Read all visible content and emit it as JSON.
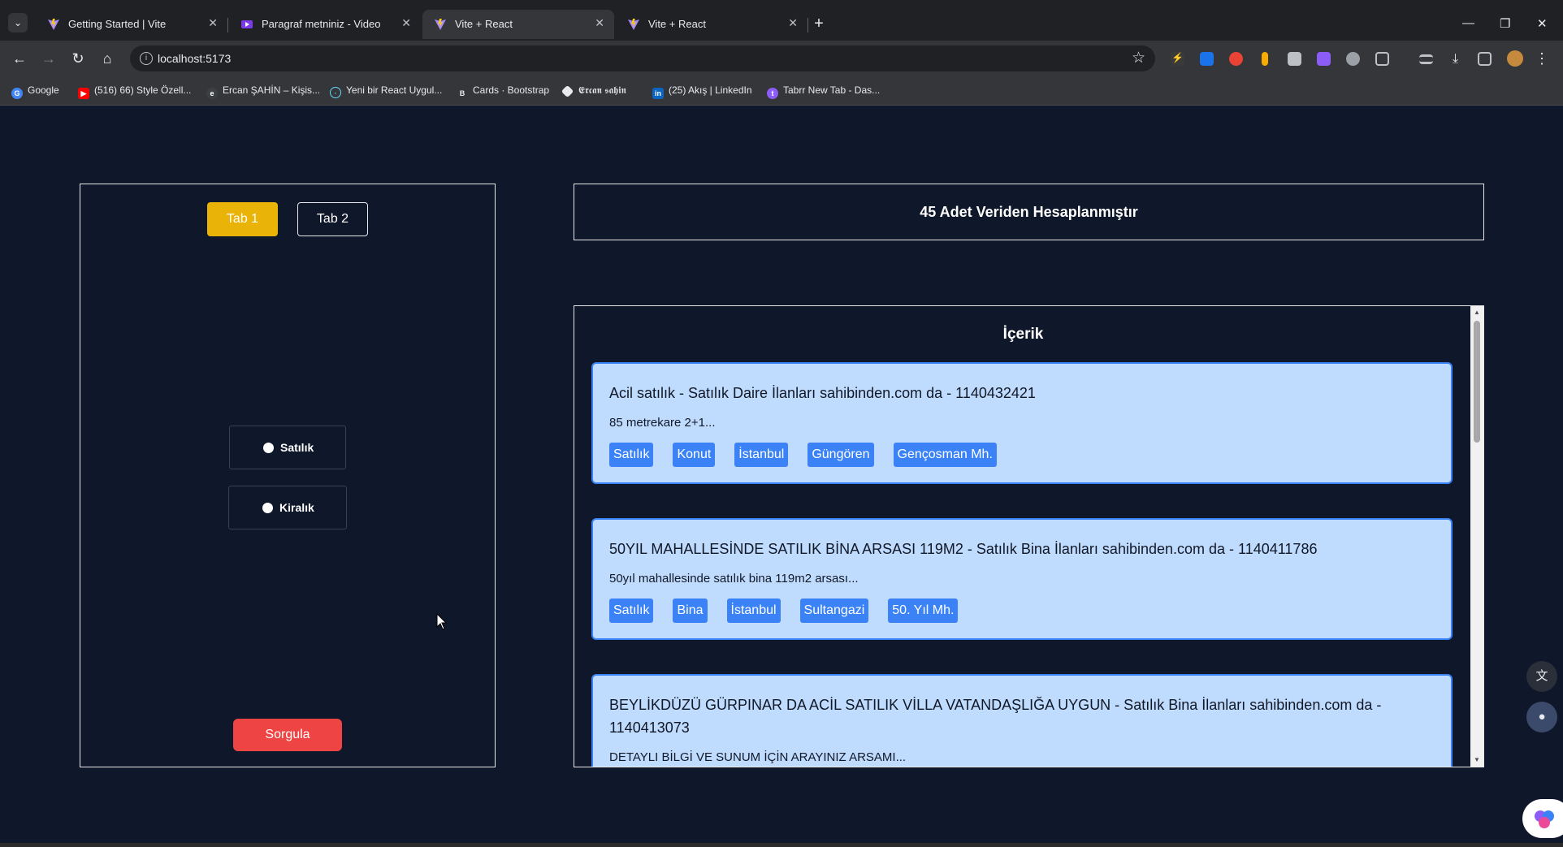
{
  "browser": {
    "tabs": [
      {
        "title": "Getting Started | Vite",
        "active": false
      },
      {
        "title": "Paragraf metniniz - Video",
        "active": false
      },
      {
        "title": "Vite + React",
        "active": true
      },
      {
        "title": "Vite + React",
        "active": false
      }
    ],
    "url": "localhost:5173",
    "bookmarks": [
      {
        "label": "Google",
        "icon": "google-icon",
        "color": "#4285f4"
      },
      {
        "label": "(516) 66) Style Özell...",
        "icon": "youtube-icon",
        "color": "#ff0000"
      },
      {
        "label": "Ercan ŞAHİN – Kişis...",
        "icon": "site-icon",
        "color": "#5f6368"
      },
      {
        "label": "Yeni bir React Uygul...",
        "icon": "react-icon",
        "color": "#61dafb"
      },
      {
        "label": "Cards · Bootstrap",
        "icon": "bootstrap-icon",
        "color": "#7952b3"
      },
      {
        "label": "𝕰𝖗𝖈𝖆𝖓 𝖘𝖆𝖍𝖎𝖓",
        "icon": "diamond-icon",
        "color": "#e8eaed"
      },
      {
        "label": "(25) Akış | LinkedIn",
        "icon": "linkedin-icon",
        "color": "#0a66c2"
      },
      {
        "label": "Tabrr New Tab - Das...",
        "icon": "tabrr-icon",
        "color": "#8b5cf6"
      }
    ]
  },
  "left_panel": {
    "tab1": "Tab 1",
    "tab2": "Tab 2",
    "radio_sale": "Satılık",
    "radio_rent": "Kiralık",
    "query_button": "Sorgula"
  },
  "summary": "45 Adet Veriden Hesaplanmıştır",
  "content": {
    "title": "İçerik",
    "cards": [
      {
        "title": "Acil satılık - Satılık Daire İlanları sahibinden.com da - 1140432421",
        "desc": "85 metrekare 2+1...",
        "tags": [
          "Satılık",
          "Konut",
          "İstanbul",
          "Güngören",
          "Gençosman Mh."
        ]
      },
      {
        "title": "50YIL MAHALLESİNDE SATILIK BİNA ARSASI 119M2 - Satılık Bina İlanları sahibinden.com da - 1140411786",
        "desc": "50yıl mahallesinde satılık bina 119m2 arsası...",
        "tags": [
          "Satılık",
          "Bina",
          "İstanbul",
          "Sultangazi",
          "50. Yıl Mh."
        ]
      },
      {
        "title": "BEYLİKDÜZÜ GÜRPINAR DA ACİL SATILIK VİLLA VATANDAŞLIĞA UYGUN - Satılık Bina İlanları sahibinden.com da - 1140413073",
        "desc": "DETAYLI BİLGİ VE SUNUM İÇİN ARAYINIZ ARSAMI...",
        "tags": []
      }
    ]
  },
  "colors": {
    "page_bg": "#0f172a",
    "tab_active": "#eab308",
    "query_button": "#ef4444",
    "card_bg": "#bfdbfe",
    "tag_bg": "#3b82f6"
  }
}
